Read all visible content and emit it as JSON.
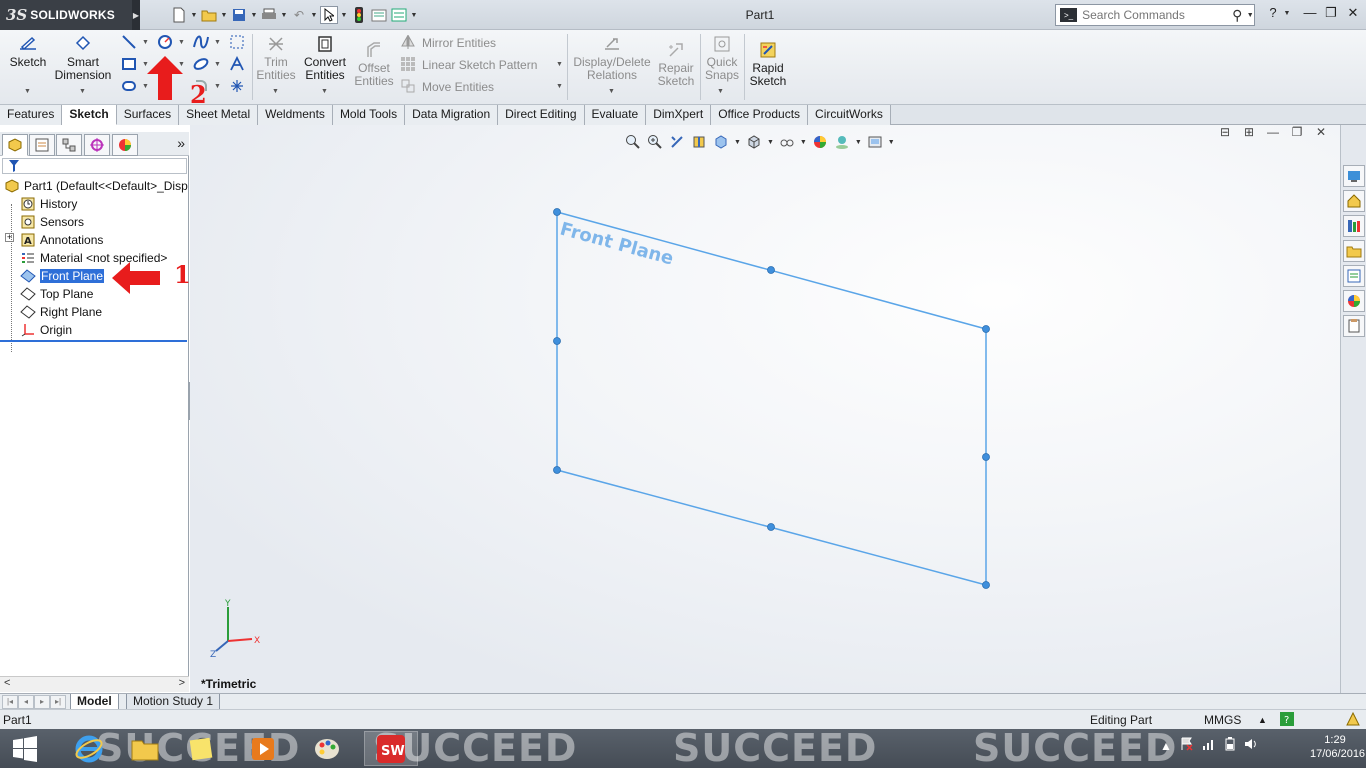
{
  "app": {
    "logo_ds": "3S",
    "logo_name": "SOLIDWORKS",
    "document_title": "Part1",
    "search_placeholder": "Search Commands"
  },
  "ribbon": {
    "sketch": "Sketch",
    "smart_dimension_1": "Smart",
    "smart_dimension_2": "Dimension",
    "trim_1": "Trim",
    "trim_2": "Entities",
    "convert_1": "Convert",
    "convert_2": "Entities",
    "offset_1": "Offset",
    "offset_2": "Entities",
    "mirror": "Mirror Entities",
    "linear_pattern": "Linear Sketch Pattern",
    "move": "Move Entities",
    "display_delete_1": "Display/Delete",
    "display_delete_2": "Relations",
    "repair_1": "Repair",
    "repair_2": "Sketch",
    "quick_snaps_1": "Quick",
    "quick_snaps_2": "Snaps",
    "rapid_1": "Rapid",
    "rapid_2": "Sketch"
  },
  "tabs": [
    "Features",
    "Sketch",
    "Surfaces",
    "Sheet Metal",
    "Weldments",
    "Mold Tools",
    "Data Migration",
    "Direct Editing",
    "Evaluate",
    "DimXpert",
    "Office Products",
    "CircuitWorks"
  ],
  "active_tab": "Sketch",
  "tree": {
    "root": "Part1  (Default<<Default>_Disp",
    "items": [
      "History",
      "Sensors",
      "Annotations",
      "Material <not specified>",
      "Front Plane",
      "Top Plane",
      "Right Plane",
      "Origin"
    ],
    "selected": "Front Plane"
  },
  "viewport": {
    "plane_label": "Front Plane",
    "view_name": "*Trimetric",
    "triad_x": "X",
    "triad_y": "Y",
    "triad_z": "Z"
  },
  "bottom_tabs": [
    "Model",
    "Motion Study 1"
  ],
  "status": {
    "left": "Part1",
    "mode": "Editing Part",
    "units": "MMGS",
    "units_caret": "▲"
  },
  "taskbar": {
    "watermark": "SUCCEED",
    "sw_label": "SW",
    "time": "1:29",
    "date": "17/06/2016"
  },
  "annotations": {
    "one": "1",
    "two": "2"
  },
  "colors": {
    "accent": "#2e6fd8",
    "plane": "#5aa5e8",
    "arrow": "#e81c1c"
  }
}
